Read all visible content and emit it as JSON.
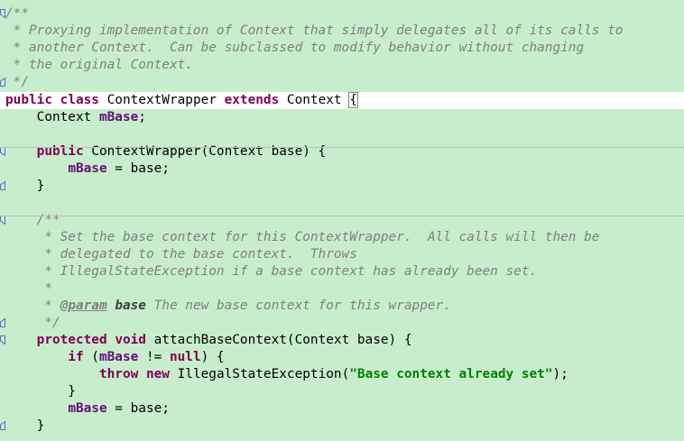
{
  "editor": {
    "lines": [
      {
        "tokens": [
          {
            "c": "tok-docgray",
            "t": "/**"
          }
        ]
      },
      {
        "tokens": [
          {
            "c": "tok-docgray",
            "t": " * Proxying implementation of Context that simply delegates all of its calls to"
          }
        ]
      },
      {
        "tokens": [
          {
            "c": "tok-docgray",
            "t": " * another Context.  Can be subclassed to modify behavior without changing"
          }
        ]
      },
      {
        "tokens": [
          {
            "c": "tok-docgray",
            "t": " * the original Context."
          }
        ]
      },
      {
        "tokens": [
          {
            "c": "tok-docgray",
            "t": " */"
          }
        ]
      },
      {
        "tokens": [
          {
            "c": "tok-kw",
            "t": "public"
          },
          {
            "c": "tok-plain",
            "t": " "
          },
          {
            "c": "tok-kw",
            "t": "class"
          },
          {
            "c": "tok-plain",
            "t": " ContextWrapper "
          },
          {
            "c": "tok-kw",
            "t": "extends"
          },
          {
            "c": "tok-plain",
            "t": " Context "
          },
          {
            "c": "caret-brace",
            "t": "{"
          }
        ]
      },
      {
        "tokens": [
          {
            "c": "tok-plain",
            "t": "    Context "
          },
          {
            "c": "tok-field2",
            "t": "mBase"
          },
          {
            "c": "tok-plain",
            "t": ";"
          }
        ]
      },
      {
        "tokens": [
          {
            "c": "tok-plain",
            "t": ""
          }
        ]
      },
      {
        "tokens": [
          {
            "c": "tok-plain",
            "t": "    "
          },
          {
            "c": "tok-kw",
            "t": "public"
          },
          {
            "c": "tok-plain",
            "t": " ContextWrapper(Context base) {"
          }
        ]
      },
      {
        "tokens": [
          {
            "c": "tok-plain",
            "t": "        "
          },
          {
            "c": "tok-field2",
            "t": "mBase"
          },
          {
            "c": "tok-plain",
            "t": " = base;"
          }
        ]
      },
      {
        "tokens": [
          {
            "c": "tok-plain",
            "t": "    }"
          }
        ]
      },
      {
        "tokens": [
          {
            "c": "tok-plain",
            "t": ""
          }
        ]
      },
      {
        "tokens": [
          {
            "c": "tok-docgray",
            "t": "    /**"
          }
        ]
      },
      {
        "tokens": [
          {
            "c": "tok-docgray",
            "t": "     * Set the base context for this ContextWrapper.  All calls will then be"
          }
        ]
      },
      {
        "tokens": [
          {
            "c": "tok-docgray",
            "t": "     * delegated to the base context.  Throws"
          }
        ]
      },
      {
        "tokens": [
          {
            "c": "tok-docgray",
            "t": "     * IllegalStateException if a base context has already been set."
          }
        ]
      },
      {
        "tokens": [
          {
            "c": "tok-docgray",
            "t": "     *"
          }
        ]
      },
      {
        "tokens": [
          {
            "c": "tok-docgray",
            "t": "     * "
          },
          {
            "c": "tok-tag",
            "t": "@param"
          },
          {
            "c": "tok-docgray",
            "t": " "
          },
          {
            "c": "tok-param",
            "t": "base"
          },
          {
            "c": "tok-docgray",
            "t": " The new base context for this wrapper."
          }
        ]
      },
      {
        "tokens": [
          {
            "c": "tok-docgray",
            "t": "     */"
          }
        ]
      },
      {
        "tokens": [
          {
            "c": "tok-plain",
            "t": "    "
          },
          {
            "c": "tok-kw",
            "t": "protected"
          },
          {
            "c": "tok-plain",
            "t": " "
          },
          {
            "c": "tok-kw",
            "t": "void"
          },
          {
            "c": "tok-plain",
            "t": " attachBaseContext(Context base) {"
          }
        ]
      },
      {
        "tokens": [
          {
            "c": "tok-plain",
            "t": "        "
          },
          {
            "c": "tok-kw",
            "t": "if"
          },
          {
            "c": "tok-plain",
            "t": " ("
          },
          {
            "c": "tok-field2",
            "t": "mBase"
          },
          {
            "c": "tok-plain",
            "t": " != "
          },
          {
            "c": "tok-kw",
            "t": "null"
          },
          {
            "c": "tok-plain",
            "t": ") {"
          }
        ]
      },
      {
        "tokens": [
          {
            "c": "tok-plain",
            "t": "            "
          },
          {
            "c": "tok-kw",
            "t": "throw"
          },
          {
            "c": "tok-plain",
            "t": " "
          },
          {
            "c": "tok-kw",
            "t": "new"
          },
          {
            "c": "tok-plain",
            "t": " IllegalStateException("
          },
          {
            "c": "tok-str",
            "t": "\"Base context already set\""
          },
          {
            "c": "tok-plain",
            "t": ");"
          }
        ]
      },
      {
        "tokens": [
          {
            "c": "tok-plain",
            "t": "        }"
          }
        ]
      },
      {
        "tokens": [
          {
            "c": "tok-plain",
            "t": "        "
          },
          {
            "c": "tok-field2",
            "t": "mBase"
          },
          {
            "c": "tok-plain",
            "t": " = base;"
          }
        ]
      },
      {
        "tokens": [
          {
            "c": "tok-plain",
            "t": "    }"
          }
        ]
      }
    ]
  },
  "colors": {
    "background": "#c7edcc",
    "current_line": "#ffffff",
    "keyword": "#7f0055",
    "field": "#660e7a",
    "comment": "#808080",
    "string": "#008000"
  },
  "icons": {
    "fold_expanded": "fold-minus-icon",
    "fold_end": "fold-end-icon"
  }
}
